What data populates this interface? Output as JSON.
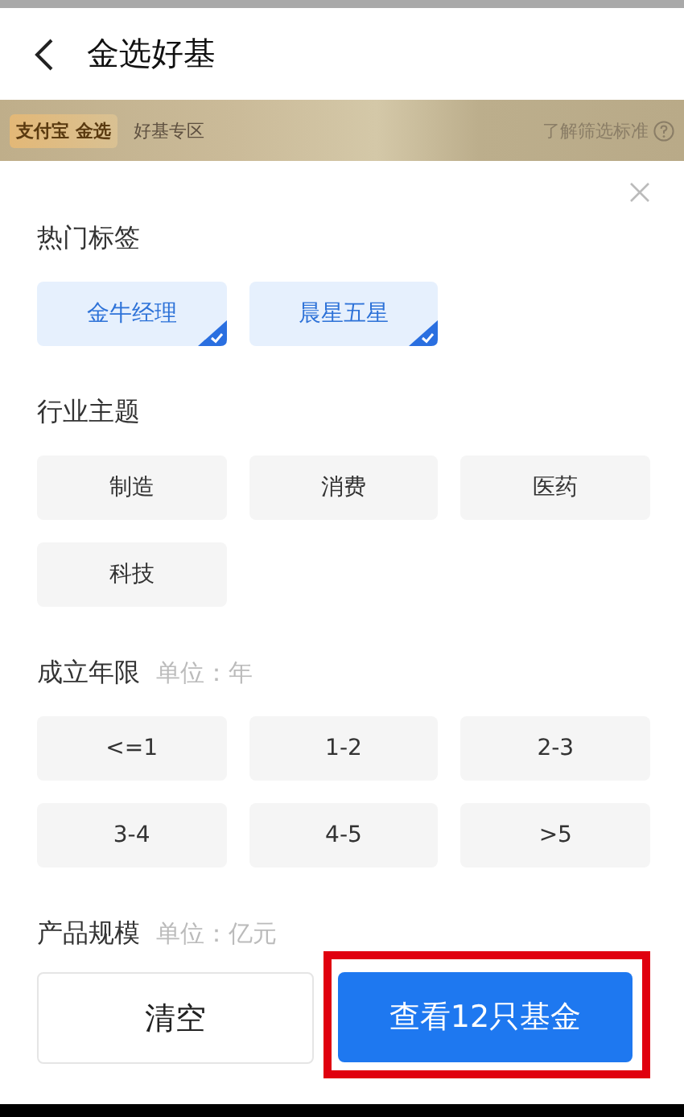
{
  "header": {
    "title": "金选好基"
  },
  "banner": {
    "badge": "支付宝 金选",
    "subtitle": "好基专区",
    "link": "了解筛选标准"
  },
  "sections": [
    {
      "title": "热门标签",
      "chips": [
        {
          "label": "金牛经理",
          "selected": true
        },
        {
          "label": "晨星五星",
          "selected": true
        }
      ]
    },
    {
      "title": "行业主题",
      "chips": [
        {
          "label": "制造",
          "selected": false
        },
        {
          "label": "消费",
          "selected": false
        },
        {
          "label": "医药",
          "selected": false
        },
        {
          "label": "科技",
          "selected": false
        }
      ]
    },
    {
      "title": "成立年限",
      "unit": "单位：年",
      "chips": [
        {
          "label": "<=1",
          "selected": false
        },
        {
          "label": "1-2",
          "selected": false
        },
        {
          "label": "2-3",
          "selected": false
        },
        {
          "label": "3-4",
          "selected": false
        },
        {
          "label": "4-5",
          "selected": false
        },
        {
          "label": ">5",
          "selected": false
        }
      ]
    },
    {
      "title": "产品规模",
      "unit": "单位：亿元"
    }
  ],
  "buttons": {
    "clear": "清空",
    "confirm": "查看12只基金",
    "confirm_highlighted": true
  }
}
